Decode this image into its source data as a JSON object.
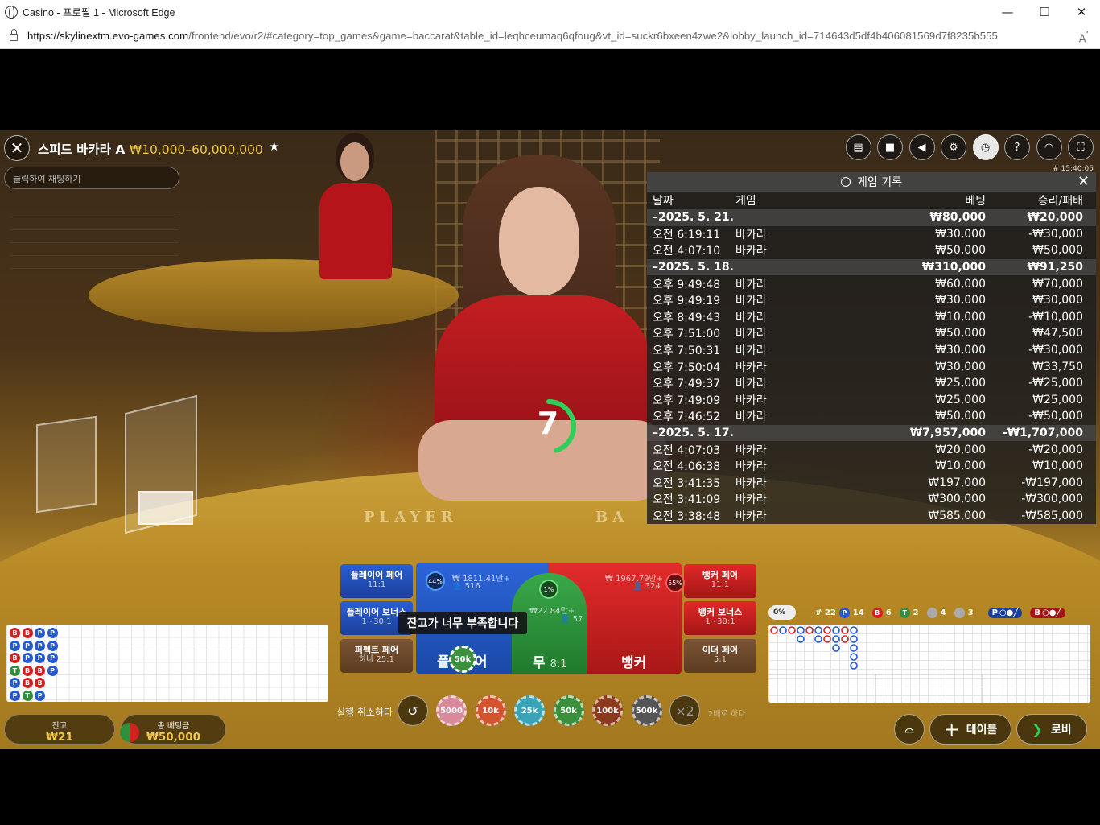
{
  "browser": {
    "window_title": "Casino - 프로필 1 - Microsoft Edge",
    "url_host": "https://skylinextm.evo-games.com",
    "url_rest": "/frontend/evo/r2/#category=top_games&game=baccarat&table_id=leqhceumaq6qfoug&vt_id=suckr6bxeen4zwe2&lobby_launch_id=714643d5df4b406081569d7f8235b555",
    "minimize": "—",
    "maximize": "☐",
    "close": "✕",
    "read_aloud": "A⁰"
  },
  "table": {
    "name": "스피드 바카라 A",
    "limits": "₩10,000–60,000,000",
    "chat_placeholder": "클릭하여 채팅하기",
    "game_id": "# 15:40:05"
  },
  "top_icons": [
    "chat-icon",
    "video-icon",
    "mute-icon",
    "settings-icon",
    "history-icon",
    "help-icon",
    "support-icon",
    "fullscreen-icon"
  ],
  "history": {
    "title": "게임 기록",
    "columns": {
      "date": "날짜",
      "game": "게임",
      "bet": "베팅",
      "result": "승리/패배"
    },
    "rows": [
      {
        "type": "date",
        "c1": "–2025. 5. 21.",
        "c2": "",
        "c3": "₩80,000",
        "c4": "₩20,000"
      },
      {
        "type": "item",
        "c1": "오전 6:19:11",
        "c2": "바카라",
        "c3": "₩30,000",
        "c4": "-₩30,000"
      },
      {
        "type": "item",
        "c1": "오전 4:07:10",
        "c2": "바카라",
        "c3": "₩50,000",
        "c4": "₩50,000"
      },
      {
        "type": "date",
        "c1": "–2025. 5. 18.",
        "c2": "",
        "c3": "₩310,000",
        "c4": "₩91,250"
      },
      {
        "type": "item",
        "c1": "오후 9:49:48",
        "c2": "바카라",
        "c3": "₩60,000",
        "c4": "₩70,000"
      },
      {
        "type": "item",
        "c1": "오후 9:49:19",
        "c2": "바카라",
        "c3": "₩30,000",
        "c4": "₩30,000"
      },
      {
        "type": "item",
        "c1": "오후 8:49:43",
        "c2": "바카라",
        "c3": "₩10,000",
        "c4": "-₩10,000"
      },
      {
        "type": "item",
        "c1": "오후 7:51:00",
        "c2": "바카라",
        "c3": "₩50,000",
        "c4": "₩47,500"
      },
      {
        "type": "item",
        "c1": "오후 7:50:31",
        "c2": "바카라",
        "c3": "₩30,000",
        "c4": "-₩30,000"
      },
      {
        "type": "item",
        "c1": "오후 7:50:04",
        "c2": "바카라",
        "c3": "₩30,000",
        "c4": "₩33,750"
      },
      {
        "type": "item",
        "c1": "오후 7:49:37",
        "c2": "바카라",
        "c3": "₩25,000",
        "c4": "-₩25,000"
      },
      {
        "type": "item",
        "c1": "오후 7:49:09",
        "c2": "바카라",
        "c3": "₩25,000",
        "c4": "₩25,000"
      },
      {
        "type": "item",
        "c1": "오후 7:46:52",
        "c2": "바카라",
        "c3": "₩50,000",
        "c4": "-₩50,000"
      },
      {
        "type": "date",
        "c1": "–2025. 5. 17.",
        "c2": "",
        "c3": "₩7,957,000",
        "c4": "-₩1,707,000"
      },
      {
        "type": "item",
        "c1": "오전 4:07:03",
        "c2": "바카라",
        "c3": "₩20,000",
        "c4": "-₩20,000"
      },
      {
        "type": "item",
        "c1": "오전 4:06:38",
        "c2": "바카라",
        "c3": "₩10,000",
        "c4": "₩10,000"
      },
      {
        "type": "item",
        "c1": "오전 3:41:35",
        "c2": "바카라",
        "c3": "₩197,000",
        "c4": "-₩197,000"
      },
      {
        "type": "item",
        "c1": "오전 3:41:09",
        "c2": "바카라",
        "c3": "₩300,000",
        "c4": "-₩300,000"
      },
      {
        "type": "item",
        "c1": "오전 3:38:48",
        "c2": "바카라",
        "c3": "₩585,000",
        "c4": "-₩585,000"
      }
    ]
  },
  "countdown": {
    "value": "7",
    "fraction": 0.45
  },
  "felt": {
    "player": "PLAYER",
    "banker": "BA"
  },
  "bets": {
    "player_pair": "플레이어 페어",
    "player_pair_odds": "11:1",
    "player_bonus": "플레이어 보너스",
    "player_bonus_odds": "1~30:1",
    "perfect_pair": "퍼펙트 페어",
    "perfect_pair_odds": "하나 25:1",
    "banker_pair": "뱅커 페어",
    "banker_pair_odds": "11:1",
    "banker_bonus": "뱅커 보너스",
    "banker_bonus_odds": "1~30:1",
    "either_pair": "이더 페어",
    "either_pair_odds": "5:1",
    "player": "플레이어",
    "tie": "무",
    "tie_odds": "8:1",
    "banker": "뱅커",
    "player_pct": "44%",
    "player_amount": "₩ 1811.41만+",
    "player_count": "516",
    "tie_pct": "1%",
    "tie_amount": "₩22.84만+",
    "tie_count": "57",
    "banker_pct": "55%",
    "banker_amount": "₩ 1967.79만+",
    "banker_count": "324",
    "placed_chip": "50k"
  },
  "toast": "잔고가 너무 부족합니다",
  "chips": {
    "undo_label": "실행 취소하다",
    "undo_icon": "↺",
    "values": [
      "5000",
      "10k",
      "25k",
      "50k",
      "100k",
      "500k"
    ],
    "colors": [
      "#d98a9a",
      "#d2552f",
      "#3aa3b5",
      "#3c8f3c",
      "#8b3a1e",
      "#555555"
    ],
    "double": "×2",
    "double_label": "2배로 하다"
  },
  "bead_road": [
    [
      "B",
      "P",
      "B",
      "T",
      "P",
      "P"
    ],
    [
      "B",
      "P",
      "P",
      "B",
      "B",
      "T"
    ],
    [
      "P",
      "P",
      "P",
      "B",
      "B",
      "P"
    ],
    [
      "P",
      "P",
      "P",
      "P",
      "",
      ""
    ]
  ],
  "road_stats": {
    "percent": "0%",
    "total": "# 22",
    "p": "14",
    "b": "6",
    "t": "2",
    "pp": "4",
    "bp": "3",
    "p_label": "P",
    "b_label": "B",
    "t_label": "T"
  },
  "balance": {
    "label": "잔고",
    "value": "₩21"
  },
  "total_bet": {
    "label": "총 베팅금",
    "value": "₩50,000"
  },
  "nav": {
    "table": "테이블",
    "lobby": "로비",
    "plus": "+"
  },
  "colors": {
    "player": "#2459d0",
    "banker": "#d42020",
    "tie": "#2f8f3c",
    "gold": "#f2c94c"
  }
}
